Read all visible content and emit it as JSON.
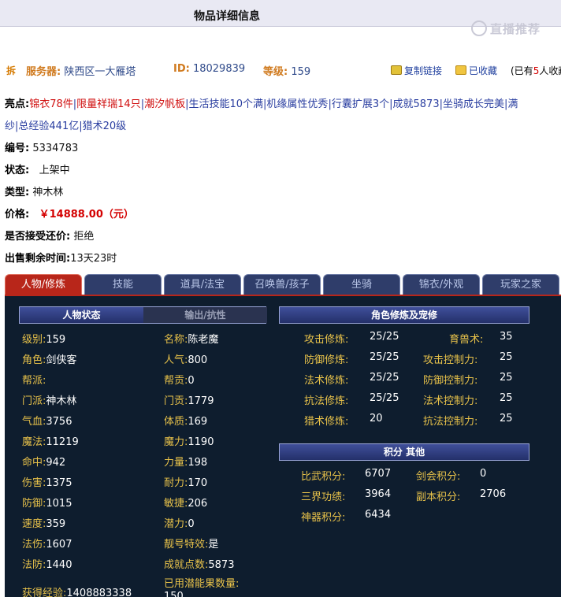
{
  "title": "物品详细信息",
  "watermark": "直播推荐",
  "server": {
    "chai_badge": "拆",
    "server_label": "服务器:",
    "server_value": "陕西区一大雁塔",
    "id_label": "ID:",
    "id_value": "18029839",
    "level_label": "等级:",
    "level_value": "159",
    "copy_link": "复制链接",
    "favorited": "已收藏",
    "fav_prefix": "(已有",
    "fav_num": "5",
    "fav_suffix": "人收藏"
  },
  "highlights": {
    "label": "亮点:",
    "items": [
      {
        "text": "锦衣78件",
        "hot": true
      },
      {
        "text": "限量祥瑞14只",
        "hot": true
      },
      {
        "text": "潮汐帆板",
        "hot": true
      },
      {
        "text": "生活技能10个满",
        "hot": false
      },
      {
        "text": "机缘属性优秀",
        "hot": false
      },
      {
        "text": "行囊扩展3个",
        "hot": false
      },
      {
        "text": "成就5873",
        "hot": false
      },
      {
        "text": "坐骑成长完美",
        "hot": false
      },
      {
        "text": "满",
        "hot": false
      },
      {
        "text": "纱",
        "hot": false
      },
      {
        "text": "总经验441亿",
        "hot": false
      },
      {
        "text": "猎术20级",
        "hot": false
      }
    ]
  },
  "info": {
    "number_label": "编号:",
    "number_value": "5334783",
    "status_label": "状态:",
    "status_value": "上架中",
    "type_label": "类型:",
    "type_value": "神木林",
    "price_label": "价格:",
    "price_value": "￥14888.00（元）",
    "bargain_label": "是否接受还价:",
    "bargain_value": "拒绝",
    "remain_label": "出售剩余时间:",
    "remain_value": "13天23时"
  },
  "tabs": [
    "人物/修炼",
    "技能",
    "道具/法宝",
    "召唤兽/孩子",
    "坐骑",
    "锦衣/外观",
    "玩家之家"
  ],
  "panel": {
    "left_header": "人物状态",
    "left_header_dim": "输出/抗性",
    "col1": [
      {
        "k": "级别:",
        "v": "159"
      },
      {
        "k": "角色:",
        "v": "剑侠客"
      },
      {
        "k": "帮派:",
        "v": ""
      },
      {
        "k": "门派:",
        "v": "神木林"
      },
      {
        "k": "气血:",
        "v": "3756"
      },
      {
        "k": "魔法:",
        "v": "11219"
      },
      {
        "k": "命中:",
        "v": "942"
      },
      {
        "k": "伤害:",
        "v": "1375"
      },
      {
        "k": "防御:",
        "v": "1015"
      },
      {
        "k": "速度:",
        "v": "359"
      },
      {
        "k": "法伤:",
        "v": "1607"
      },
      {
        "k": "法防:",
        "v": "1440"
      },
      {
        "k": "获得经验:",
        "v": "1408883338"
      }
    ],
    "col2": [
      {
        "k": "名称:",
        "v": "陈老魔"
      },
      {
        "k": "人气:",
        "v": "800"
      },
      {
        "k": "帮贡:",
        "v": "0"
      },
      {
        "k": "门贡:",
        "v": "1779"
      },
      {
        "k": "体质:",
        "v": "169"
      },
      {
        "k": "魔力:",
        "v": "1190"
      },
      {
        "k": "力量:",
        "v": "198"
      },
      {
        "k": "耐力:",
        "v": "170"
      },
      {
        "k": "敏捷:",
        "v": "206"
      },
      {
        "k": "潜力:",
        "v": "0"
      },
      {
        "k": "靓号特效:",
        "v": "是"
      },
      {
        "k": "成就点数:",
        "v": "5873"
      },
      {
        "k": "已用潜能果数量:",
        "v": "150"
      }
    ],
    "right_header": "角色修炼及宠修",
    "cultivation": [
      {
        "k": "攻击修炼:",
        "v": "25/25",
        "k2": "育兽术:",
        "v2": "35"
      },
      {
        "k": "防御修炼:",
        "v": "25/25",
        "k2": "攻击控制力:",
        "v2": "25"
      },
      {
        "k": "法术修炼:",
        "v": "25/25",
        "k2": "防御控制力:",
        "v2": "25"
      },
      {
        "k": "抗法修炼:",
        "v": "25/25",
        "k2": "法术控制力:",
        "v2": "25"
      },
      {
        "k": "猎术修炼:",
        "v": "20",
        "k2": "抗法控制力:",
        "v2": "25"
      }
    ],
    "score_header": "积分 其他",
    "scores": [
      {
        "k": "比武积分:",
        "v": "6707",
        "k2": "剑会积分:",
        "v2": "0"
      },
      {
        "k": "三界功绩:",
        "v": "3964",
        "k2": "副本积分:",
        "v2": "2706"
      },
      {
        "k": "神器积分:",
        "v": "6434",
        "k2": "",
        "v2": ""
      }
    ]
  }
}
